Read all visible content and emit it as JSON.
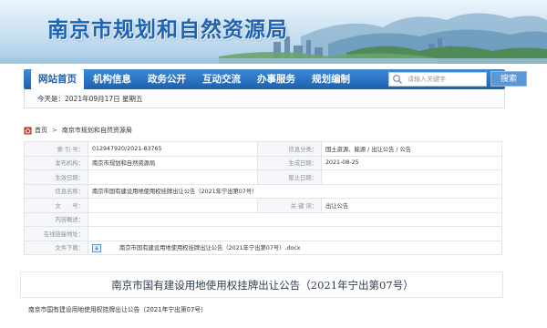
{
  "site": {
    "title": "南京市规划和自然资源局"
  },
  "nav": {
    "items": [
      {
        "label": "网站首页",
        "active": true
      },
      {
        "label": "机构信息",
        "active": false
      },
      {
        "label": "政务公开",
        "active": false
      },
      {
        "label": "互动交流",
        "active": false
      },
      {
        "label": "办事服务",
        "active": false
      },
      {
        "label": "规划编制",
        "active": false
      }
    ],
    "search_placeholder": "请输入关键字",
    "search_button": "搜索"
  },
  "date_bar": {
    "text": "今天是：2021年09月17日 星期五"
  },
  "breadcrumb": {
    "home": "首页",
    "separator": ">",
    "current": "南京市规划和自然资源局"
  },
  "info": {
    "index_label": "索 引 号：",
    "index_value": "012947920/2021-83765",
    "category_label": "信息分类：",
    "category_value": "国土资源、能源 / 出让公告 / 公告",
    "publisher_label": "发布机构：",
    "publisher_value": "南京市规划和自然资源局",
    "created_label": "生成日期：",
    "created_value": "2021-08-25",
    "effective_label": "生效日期：",
    "effective_value": "",
    "expire_label": "废止日期：",
    "expire_value": "",
    "name_label": "信息名称：",
    "name_value": "南京市国有建设用地使用权挂牌出让公告（2021年宁出第07号）",
    "docno_label": "文　　号：",
    "docno_value": "",
    "keywords_label": "关 键 词：",
    "keywords_value": "出让公告",
    "summary_label": "内容概述：",
    "summary_value": "",
    "link_label": "在线链接地址：",
    "link_value": "",
    "file_label": "文件下载：",
    "file_value": "南京市国有建设用地使用权挂牌出让公告（2021年宁出第07号）.docx"
  },
  "article": {
    "title": "南京市国有建设用地使用权挂牌出让公告（2021年宁出第07号）",
    "body_first_line": "南京市国有建设用地使用权挂牌出让公告（2021年宁出第07号）"
  }
}
